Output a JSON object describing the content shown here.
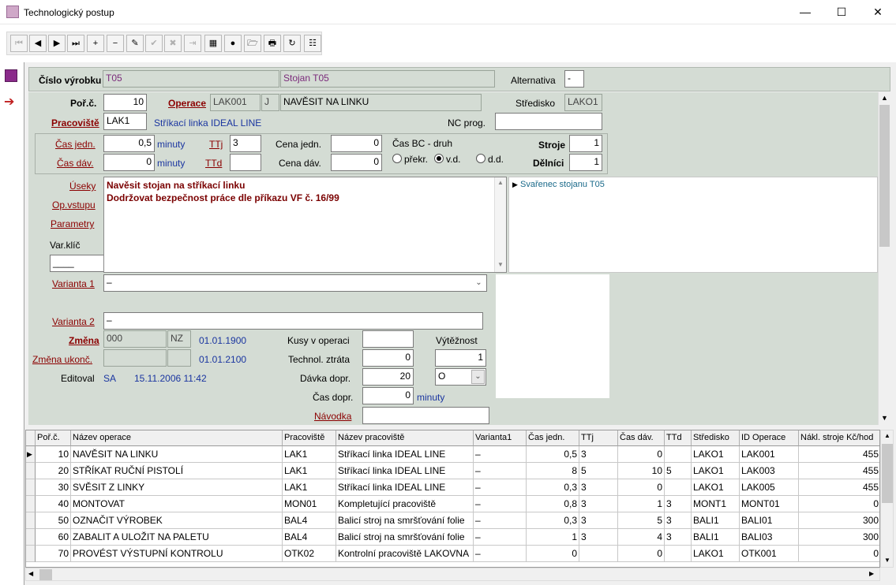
{
  "window": {
    "title": "Technologický postup",
    "minimize": "—",
    "maximize": "☐",
    "close": "✕"
  },
  "toolbar": [
    {
      "name": "first-record-button",
      "glyph": "⏮",
      "disabled": true
    },
    {
      "name": "prev-record-button",
      "glyph": "◀",
      "disabled": false
    },
    {
      "name": "next-record-button",
      "glyph": "▶",
      "disabled": false
    },
    {
      "name": "last-record-button",
      "glyph": "⏭",
      "disabled": false
    },
    {
      "name": "insert-record-button",
      "glyph": "+",
      "disabled": false
    },
    {
      "name": "delete-record-button",
      "glyph": "−",
      "disabled": false
    },
    {
      "name": "edit-record-button",
      "glyph": "✎",
      "disabled": false
    },
    {
      "name": "confirm-button",
      "glyph": "✔",
      "disabled": true
    },
    {
      "name": "cancel-button",
      "glyph": "✖",
      "disabled": true
    },
    {
      "name": "copy-button",
      "glyph": "⇥",
      "disabled": true
    },
    {
      "name": "table-view-button",
      "glyph": "▦",
      "disabled": false
    },
    {
      "name": "color-button",
      "glyph": "●",
      "disabled": false
    },
    {
      "name": "open-folder-button",
      "glyph": "🗁",
      "disabled": false
    },
    {
      "name": "print-button",
      "glyph": "🖶",
      "disabled": false
    },
    {
      "name": "refresh-button",
      "glyph": "↻",
      "disabled": false
    },
    {
      "name": "tree-view-button",
      "glyph": "☷",
      "disabled": false
    }
  ],
  "header": {
    "cislo_label": "Číslo výrobku",
    "cislo_value": "T05",
    "nazev_value": "Stojan T05",
    "alt_label": "Alternativa",
    "alt_value": "-"
  },
  "form": {
    "porc_label": "Poř.č.",
    "porc_value": "10",
    "operace_label": "Operace",
    "operace_code": "LAK001",
    "operace_flag": "J",
    "operace_name": "NAVĚSIT NA LINKU",
    "stredisko_label": "Středisko",
    "stredisko_value": "LAKO1",
    "pracoviste_label": "Pracoviště",
    "pracoviste_value": "LAK1",
    "pracoviste_name": "Stříkací linka IDEAL LINE",
    "nc_label": "NC prog.",
    "nc_value": "",
    "casjedn_label": "Čas jedn.",
    "casjedn_value": "0,5",
    "minuty1": "minuty",
    "casdav_label": "Čas dáv.",
    "casdav_value": "0",
    "minuty2": "minuty",
    "ttj_label": "TTj",
    "ttj_value": "3",
    "ttd_label": "TTd",
    "ttd_value": "",
    "cenajedn_label": "Cena jedn.",
    "cenajedn_value": "0",
    "cenadav_label": "Cena dáv.",
    "cenadav_value": "0",
    "casbc_label": "Čas BC - druh",
    "radio1": "překr.",
    "radio2": "v.d.",
    "radio3": "d.d.",
    "stroje_label": "Stroje",
    "stroje_value": "1",
    "delnici_label": "Dělníci",
    "delnici_value": "1",
    "useky_label": "Úseky",
    "opvstupu_label": "Op.vstupu",
    "parametry_label": "Parametry",
    "varklic_label": "Var.klíč",
    "varklic_value": "____",
    "text_line1": "Navěsit stojan na stříkací linku",
    "text_line2": "Dodržovat bezpečnost práce dle příkazu VF č. 16/99",
    "tree_item": "Svařenec stojanu T05",
    "varianta1_label": "Varianta 1",
    "varianta1_value": "–",
    "varianta2_label": "Varianta 2",
    "varianta2_value": "–",
    "zmena_label": "Změna",
    "zmena_value": "000",
    "zmena_nz": "NZ",
    "zmena_date": "01.01.1900",
    "zmenaukonc_label": "Změna ukonč.",
    "zmenaukonc_date": "01.01.2100",
    "editoval_label": "Editoval",
    "editoval_user": "SA",
    "editoval_date": "15.11.2006 11:42",
    "kusy_label": "Kusy v operaci",
    "kusy_value": "",
    "ztrata_label": "Technol. ztráta",
    "ztrata_value": "0",
    "davka_label": "Dávka dopr.",
    "davka_value": "20",
    "casdopr_label": "Čas dopr.",
    "casdopr_value": "0",
    "minuty3": "minuty",
    "navodka_label": "Návodka",
    "navodka_value": "",
    "vytez_label": "Výtěžnost",
    "vytez_value": "1",
    "vytez_select": "O"
  },
  "grid": {
    "columns": [
      "Poř.č.",
      "Název operace",
      "Pracoviště",
      "Název pracoviště",
      "Varianta1",
      "Čas jedn.",
      "TTj",
      "Čas dáv.",
      "TTd",
      "Středisko",
      "ID Operace",
      "Nákl. stroje Kč/hod"
    ],
    "rows": [
      [
        "10",
        "NAVĚSIT NA LINKU",
        "LAK1",
        "Stříkací linka IDEAL LINE",
        "–",
        "0,5",
        "3",
        "0",
        "",
        "LAKO1",
        "LAK001",
        "455"
      ],
      [
        "20",
        "STŘÍKAT RUČNÍ PISTOLÍ",
        "LAK1",
        "Stříkací linka IDEAL LINE",
        "–",
        "8",
        "5",
        "10",
        "5",
        "LAKO1",
        "LAK003",
        "455"
      ],
      [
        "30",
        "SVĚSIT Z LINKY",
        "LAK1",
        "Stříkací linka IDEAL LINE",
        "–",
        "0,3",
        "3",
        "0",
        "",
        "LAKO1",
        "LAK005",
        "455"
      ],
      [
        "40",
        "MONTOVAT",
        "MON01",
        "Kompletující pracoviště",
        "–",
        "0,8",
        "3",
        "1",
        "3",
        "MONT1",
        "MONT01",
        "0"
      ],
      [
        "50",
        "OZNAČIT VÝROBEK",
        "BAL4",
        "Balicí stroj na smršťování folie",
        "–",
        "0,3",
        "3",
        "5",
        "3",
        "BALI1",
        "BALI01",
        "300"
      ],
      [
        "60",
        "ZABALIT A ULOŽIT NA PALETU",
        "BAL4",
        "Balicí stroj na smršťování folie",
        "–",
        "1",
        "3",
        "4",
        "3",
        "BALI1",
        "BALI03",
        "300"
      ],
      [
        "70",
        "PROVÉST VÝSTUPNÍ KONTROLU",
        "OTK02",
        "Kontrolní pracoviště LAKOVNA",
        "–",
        "0",
        "",
        "0",
        "",
        "LAKO1",
        "OTK001",
        "0"
      ]
    ]
  },
  "colors": {
    "panel": "#d4dcd4",
    "label_red": "#8b0000",
    "text_blue": "#1a35a0",
    "text_maroon": "#7a0000"
  }
}
